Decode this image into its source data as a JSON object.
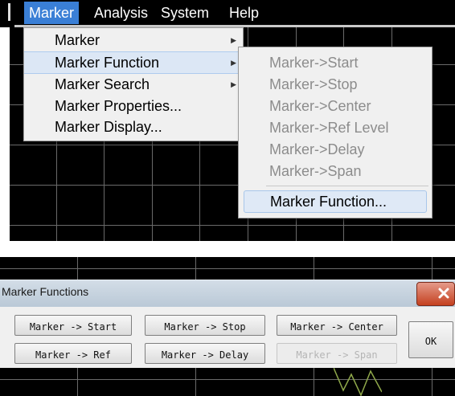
{
  "menubar": {
    "items": [
      {
        "label": "Marker",
        "active": true
      },
      {
        "label": "Analysis"
      },
      {
        "label": "System"
      },
      {
        "label": "Help"
      }
    ]
  },
  "marker_menu": {
    "items": [
      {
        "label": "Marker",
        "submenu": true
      },
      {
        "label": "Marker Function",
        "submenu": true,
        "highlighted": true
      },
      {
        "label": "Marker Search",
        "submenu": true
      },
      {
        "label": "Marker Properties..."
      },
      {
        "label": "Marker Display..."
      }
    ]
  },
  "marker_function_submenu": {
    "items": [
      {
        "label": "Marker->Start",
        "enabled": false
      },
      {
        "label": "Marker->Stop",
        "enabled": false
      },
      {
        "label": "Marker->Center",
        "enabled": false
      },
      {
        "label": "Marker->Ref Level",
        "enabled": false
      },
      {
        "label": "Marker->Delay",
        "enabled": false
      },
      {
        "label": "Marker->Span",
        "enabled": false
      },
      {
        "label": "Marker Function...",
        "enabled": true
      }
    ]
  },
  "dialog": {
    "title": "Marker Functions",
    "buttons": {
      "start": "Marker -> Start",
      "stop": "Marker -> Stop",
      "center": "Marker -> Center",
      "ref": "Marker -> Ref",
      "delay": "Marker -> Delay",
      "span": "Marker -> Span",
      "ok": "OK"
    },
    "span_enabled": false
  },
  "colors": {
    "menu_active": "#3a7fd6",
    "screen_background": "#000000",
    "grid": "#6a6a6a",
    "disabled_text": "#8c8c8c",
    "close_button": "#c4401f"
  }
}
